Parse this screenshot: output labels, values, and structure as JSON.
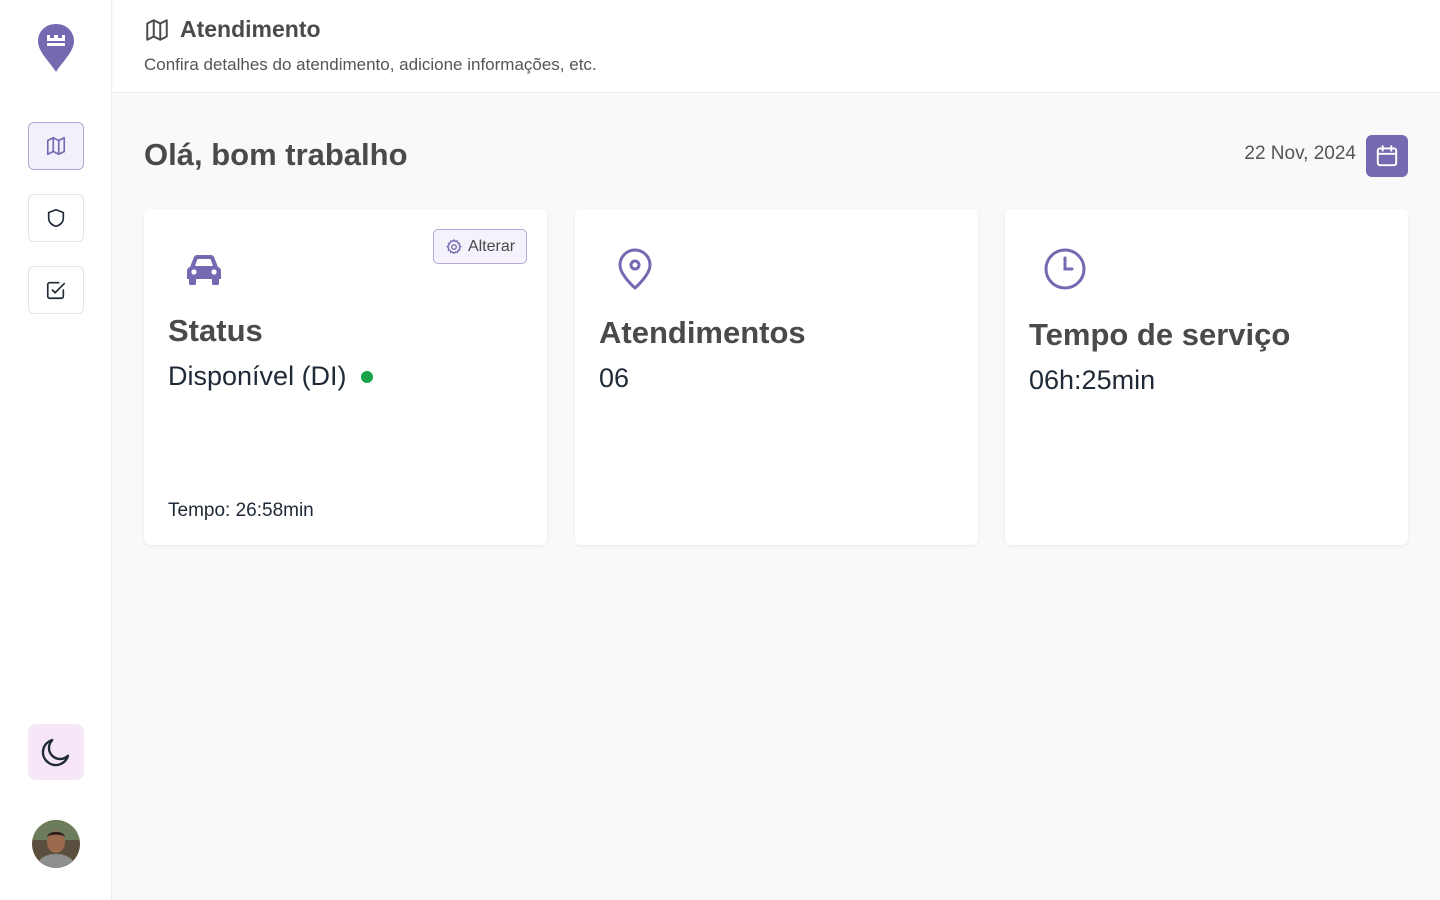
{
  "header": {
    "title": "Atendimento",
    "subtitle": "Confira detalhes do atendimento, adicione informações, etc."
  },
  "main": {
    "greeting": "Olá, bom trabalho",
    "date": "22 Nov, 2024"
  },
  "cards": {
    "status": {
      "title": "Status",
      "value": "Disponível (DI)",
      "button_label": "Alterar",
      "tempo": "Tempo: 26:58min"
    },
    "atendimentos": {
      "title": "Atendimentos",
      "value": "06"
    },
    "tempo_servico": {
      "title": "Tempo de serviço",
      "value": "06h:25min"
    }
  },
  "colors": {
    "accent": "#7569b1",
    "status_available": "#16a34a",
    "theme_button_bg": "#f7e6f7"
  },
  "icons": {
    "logo": "map-pin-logo-icon",
    "nav": [
      "map-icon",
      "shield-icon",
      "check-square-icon"
    ],
    "theme": "moon-icon",
    "calendar": "calendar-icon",
    "cards": [
      "car-icon",
      "map-pin-icon",
      "clock-icon"
    ],
    "settings": "gear-icon"
  }
}
